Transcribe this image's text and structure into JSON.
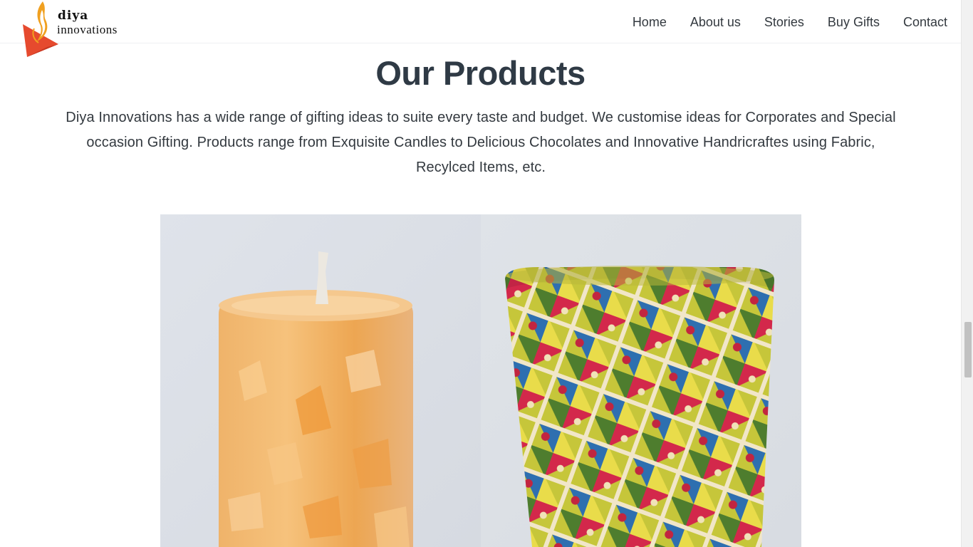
{
  "brand": {
    "line1": "diya",
    "line2": "innovations",
    "logo_icon": "flame-diya-logo-icon",
    "colors": {
      "flame": "#f0a020",
      "lamp": "#e64a2e"
    }
  },
  "nav": {
    "items": [
      {
        "label": "Home"
      },
      {
        "label": "About us"
      },
      {
        "label": "Stories"
      },
      {
        "label": "Buy Gifts"
      },
      {
        "label": "Contact"
      }
    ]
  },
  "section": {
    "title": "Our Products",
    "description": "Diya Innovations has a wide range of gifting ideas to suite every taste and budget. We customise ideas for Corporates and Special occasion Gifting. Products range from Exquisite Candles to Delicious Chocolates and Innovative Handricraftes using Fabric, Recylced Items, etc."
  },
  "products": [
    {
      "image": "candle-image"
    },
    {
      "image": "fabric-pot-image"
    }
  ],
  "colors": {
    "heading": "#2f3a45",
    "text": "#33393f",
    "photo_bg": "#dfe3e8"
  }
}
